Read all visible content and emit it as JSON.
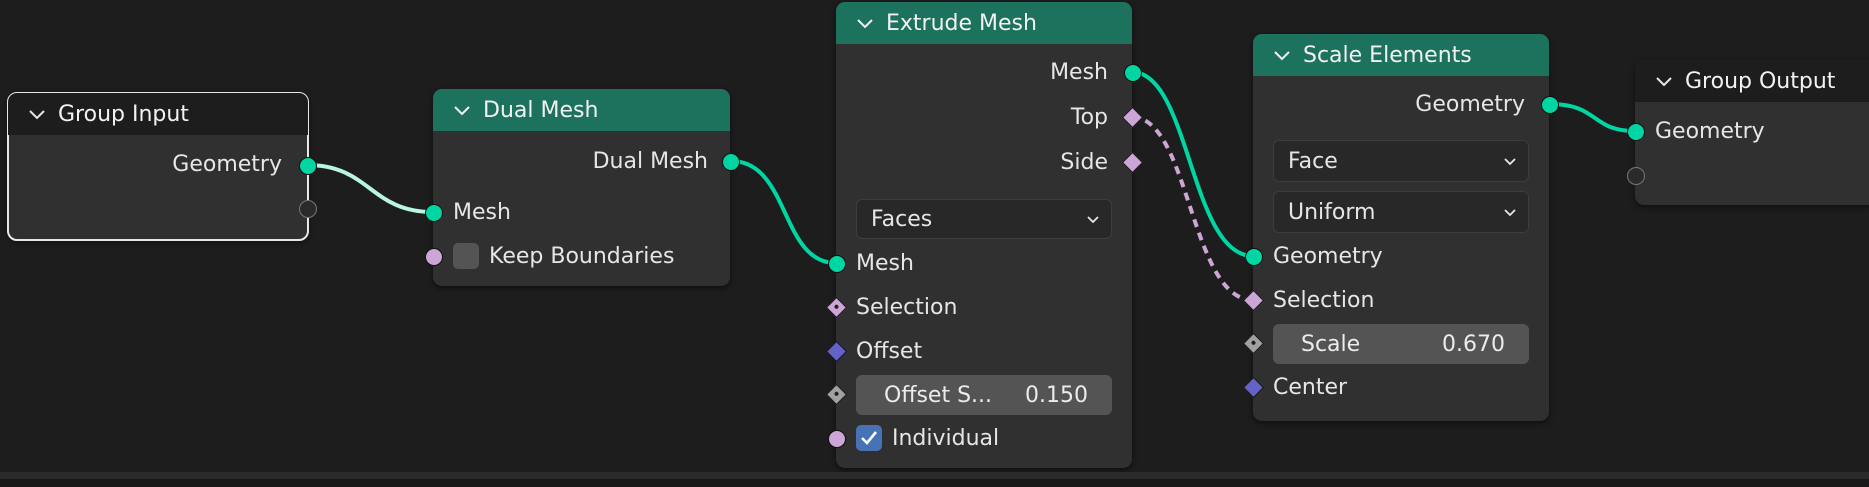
{
  "colors": {
    "geometry_socket": "#00d6a3",
    "boolean_socket": "#cca6d6",
    "vector_socket": "#6363c7",
    "float_socket": "#a1a1a1",
    "header_geometry": "#1d725e",
    "node_body": "#303030",
    "background": "#1d1d1d",
    "checkbox_checked": "#4772b3"
  },
  "nodes": {
    "group_input": {
      "title": "Group Input",
      "outputs": [
        "Geometry"
      ]
    },
    "dual_mesh": {
      "title": "Dual Mesh",
      "output": "Dual Mesh",
      "input_mesh": "Mesh",
      "keep_boundaries": "Keep Boundaries",
      "keep_boundaries_checked": false
    },
    "extrude_mesh": {
      "title": "Extrude Mesh",
      "outputs": [
        "Mesh",
        "Top",
        "Side"
      ],
      "mode": "Faces",
      "inputs": {
        "mesh": "Mesh",
        "selection": "Selection",
        "offset": "Offset",
        "offset_scale_label": "Offset S...",
        "offset_scale_value": "0.150",
        "individual": "Individual"
      },
      "individual_checked": true
    },
    "scale_elements": {
      "title": "Scale Elements",
      "output": "Geometry",
      "domain": "Face",
      "scale_mode": "Uniform",
      "inputs": {
        "geometry": "Geometry",
        "selection": "Selection",
        "scale_label": "Scale",
        "scale_value": "0.670",
        "center": "Center"
      }
    },
    "group_output": {
      "title": "Group Output",
      "inputs": [
        "Geometry"
      ]
    }
  },
  "icons": [
    "chevron-down-icon",
    "dropdown-arrow-icon",
    "checkmark-icon"
  ]
}
